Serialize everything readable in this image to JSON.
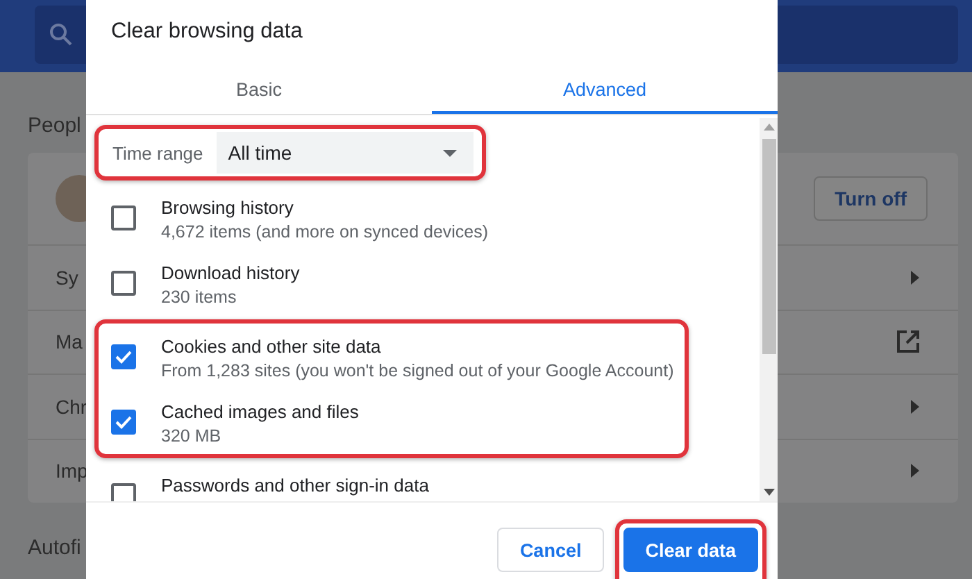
{
  "background": {
    "section_title": "Peopl",
    "turn_off_button": "Turn off",
    "rows": [
      {
        "label": "Sy",
        "kind": "arrow"
      },
      {
        "label": "Ma",
        "kind": "external"
      },
      {
        "label": "Chr",
        "kind": "arrow"
      },
      {
        "label": "Imp",
        "kind": "arrow"
      }
    ],
    "next_section_title": "Autofi"
  },
  "dialog": {
    "title": "Clear browsing data",
    "tabs": [
      {
        "label": "Basic",
        "selected": false
      },
      {
        "label": "Advanced",
        "selected": true
      }
    ],
    "time_range": {
      "label": "Time range",
      "value": "All time",
      "highlighted": true
    },
    "items": [
      {
        "title": "Browsing history",
        "detail": "4,672 items (and more on synced devices)",
        "checked": false,
        "highlighted": false
      },
      {
        "title": "Download history",
        "detail": "230 items",
        "checked": false,
        "highlighted": false
      },
      {
        "title": "Cookies and other site data",
        "detail": "From 1,283 sites (you won't be signed out of your Google Account)",
        "checked": true,
        "highlighted": true
      },
      {
        "title": "Cached images and files",
        "detail": "320 MB",
        "checked": true,
        "highlighted": true
      },
      {
        "title": "Passwords and other sign-in data",
        "checked": false,
        "highlighted": false
      }
    ],
    "buttons": [
      {
        "label": "Cancel",
        "kind": "secondary",
        "highlighted": false
      },
      {
        "label": "Clear data",
        "kind": "primary",
        "highlighted": true
      }
    ]
  }
}
